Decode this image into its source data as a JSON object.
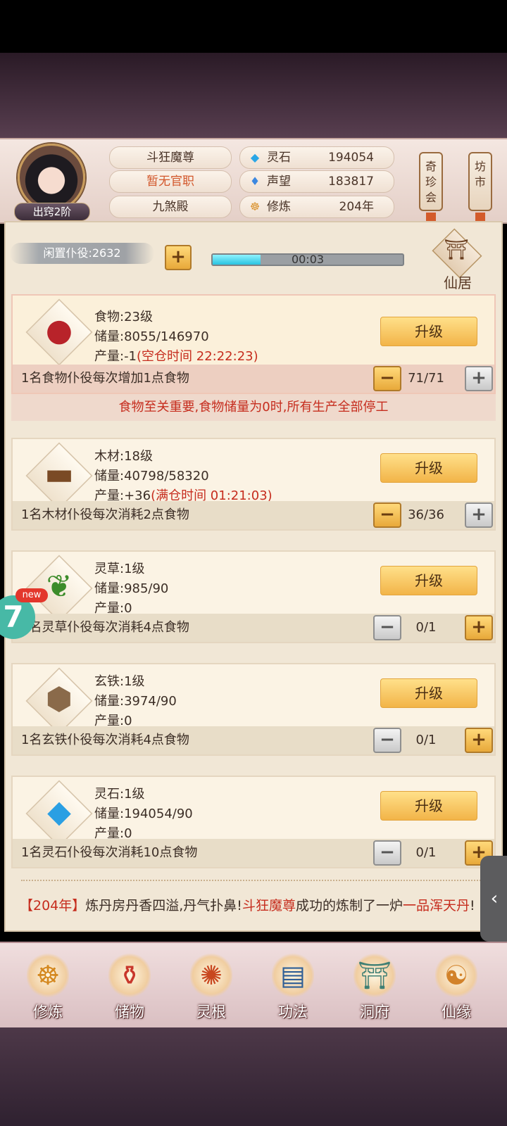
{
  "player": {
    "rank": "出窍2阶",
    "name": "斗狂魔尊",
    "title": "暂无官职",
    "sect": "九煞殿"
  },
  "resources": [
    {
      "icon": "spirit-stone-icon",
      "label": "灵石",
      "value": "194054"
    },
    {
      "icon": "reputation-icon",
      "label": "声望",
      "value": "183817"
    },
    {
      "icon": "cultivation-icon",
      "label": "修炼",
      "value": "204年"
    }
  ],
  "side_buttons": {
    "treasure": "奇珍会",
    "market": "坊市"
  },
  "idle": {
    "label": "闲置仆役:2632",
    "timer": "00:03",
    "progress": 0.25
  },
  "residence": {
    "label": "仙居"
  },
  "upgrade_label": "升级",
  "production": [
    {
      "icon": "meat-icon",
      "name_level": "食物:23级",
      "storage": "储量:8055/146970",
      "output": "产量:-1",
      "note": "(空仓时间 22:22:23)",
      "desc": "1名食物仆役每次增加1点食物",
      "count": "71/71"
    },
    {
      "icon": "wood-icon",
      "name_level": "木材:18级",
      "storage": "储量:40798/58320",
      "output": "产量:+36",
      "note": "(满仓时间 01:21:03)",
      "desc": "1名木材仆役每次消耗2点食物",
      "count": "36/36"
    },
    {
      "icon": "herb-icon",
      "name_level": "灵草:1级",
      "storage": "储量:985/90",
      "output": "产量:0",
      "note": "",
      "desc": "1名灵草仆役每次消耗4点食物",
      "count": "0/1"
    },
    {
      "icon": "iron-ore-icon",
      "name_level": "玄铁:1级",
      "storage": "储量:3974/90",
      "output": "产量:0",
      "note": "",
      "desc": "1名玄铁仆役每次消耗4点食物",
      "count": "0/1"
    },
    {
      "icon": "spirit-stone-icon",
      "name_level": "灵石:1级",
      "storage": "储量:194054/90",
      "output": "产量:0",
      "note": "",
      "desc": "1名灵石仆役每次消耗10点食物",
      "count": "0/1"
    }
  ],
  "warning": "食物至关重要,食物储量为0时,所有生产全部停工",
  "log": {
    "year": "【204年】",
    "text1": "炼丹房丹香四溢,丹气扑鼻!",
    "actor": "斗狂魔尊",
    "text2": "成功的炼制了一炉",
    "item": "一品浑天丹",
    "end": "!"
  },
  "floating": {
    "badge": "7",
    "new": "new"
  },
  "nav": [
    {
      "icon": "cultivate-icon",
      "label": "修炼"
    },
    {
      "icon": "storage-bag-icon",
      "label": "储物"
    },
    {
      "icon": "spirit-root-icon",
      "label": "灵根"
    },
    {
      "icon": "technique-book-icon",
      "label": "功法"
    },
    {
      "icon": "cave-mansion-icon",
      "label": "洞府"
    },
    {
      "icon": "fate-icon",
      "label": "仙缘"
    }
  ],
  "colors": {
    "accent_red": "#c62d1e",
    "gold": "#f2b448",
    "progress": "#29c3e0"
  }
}
